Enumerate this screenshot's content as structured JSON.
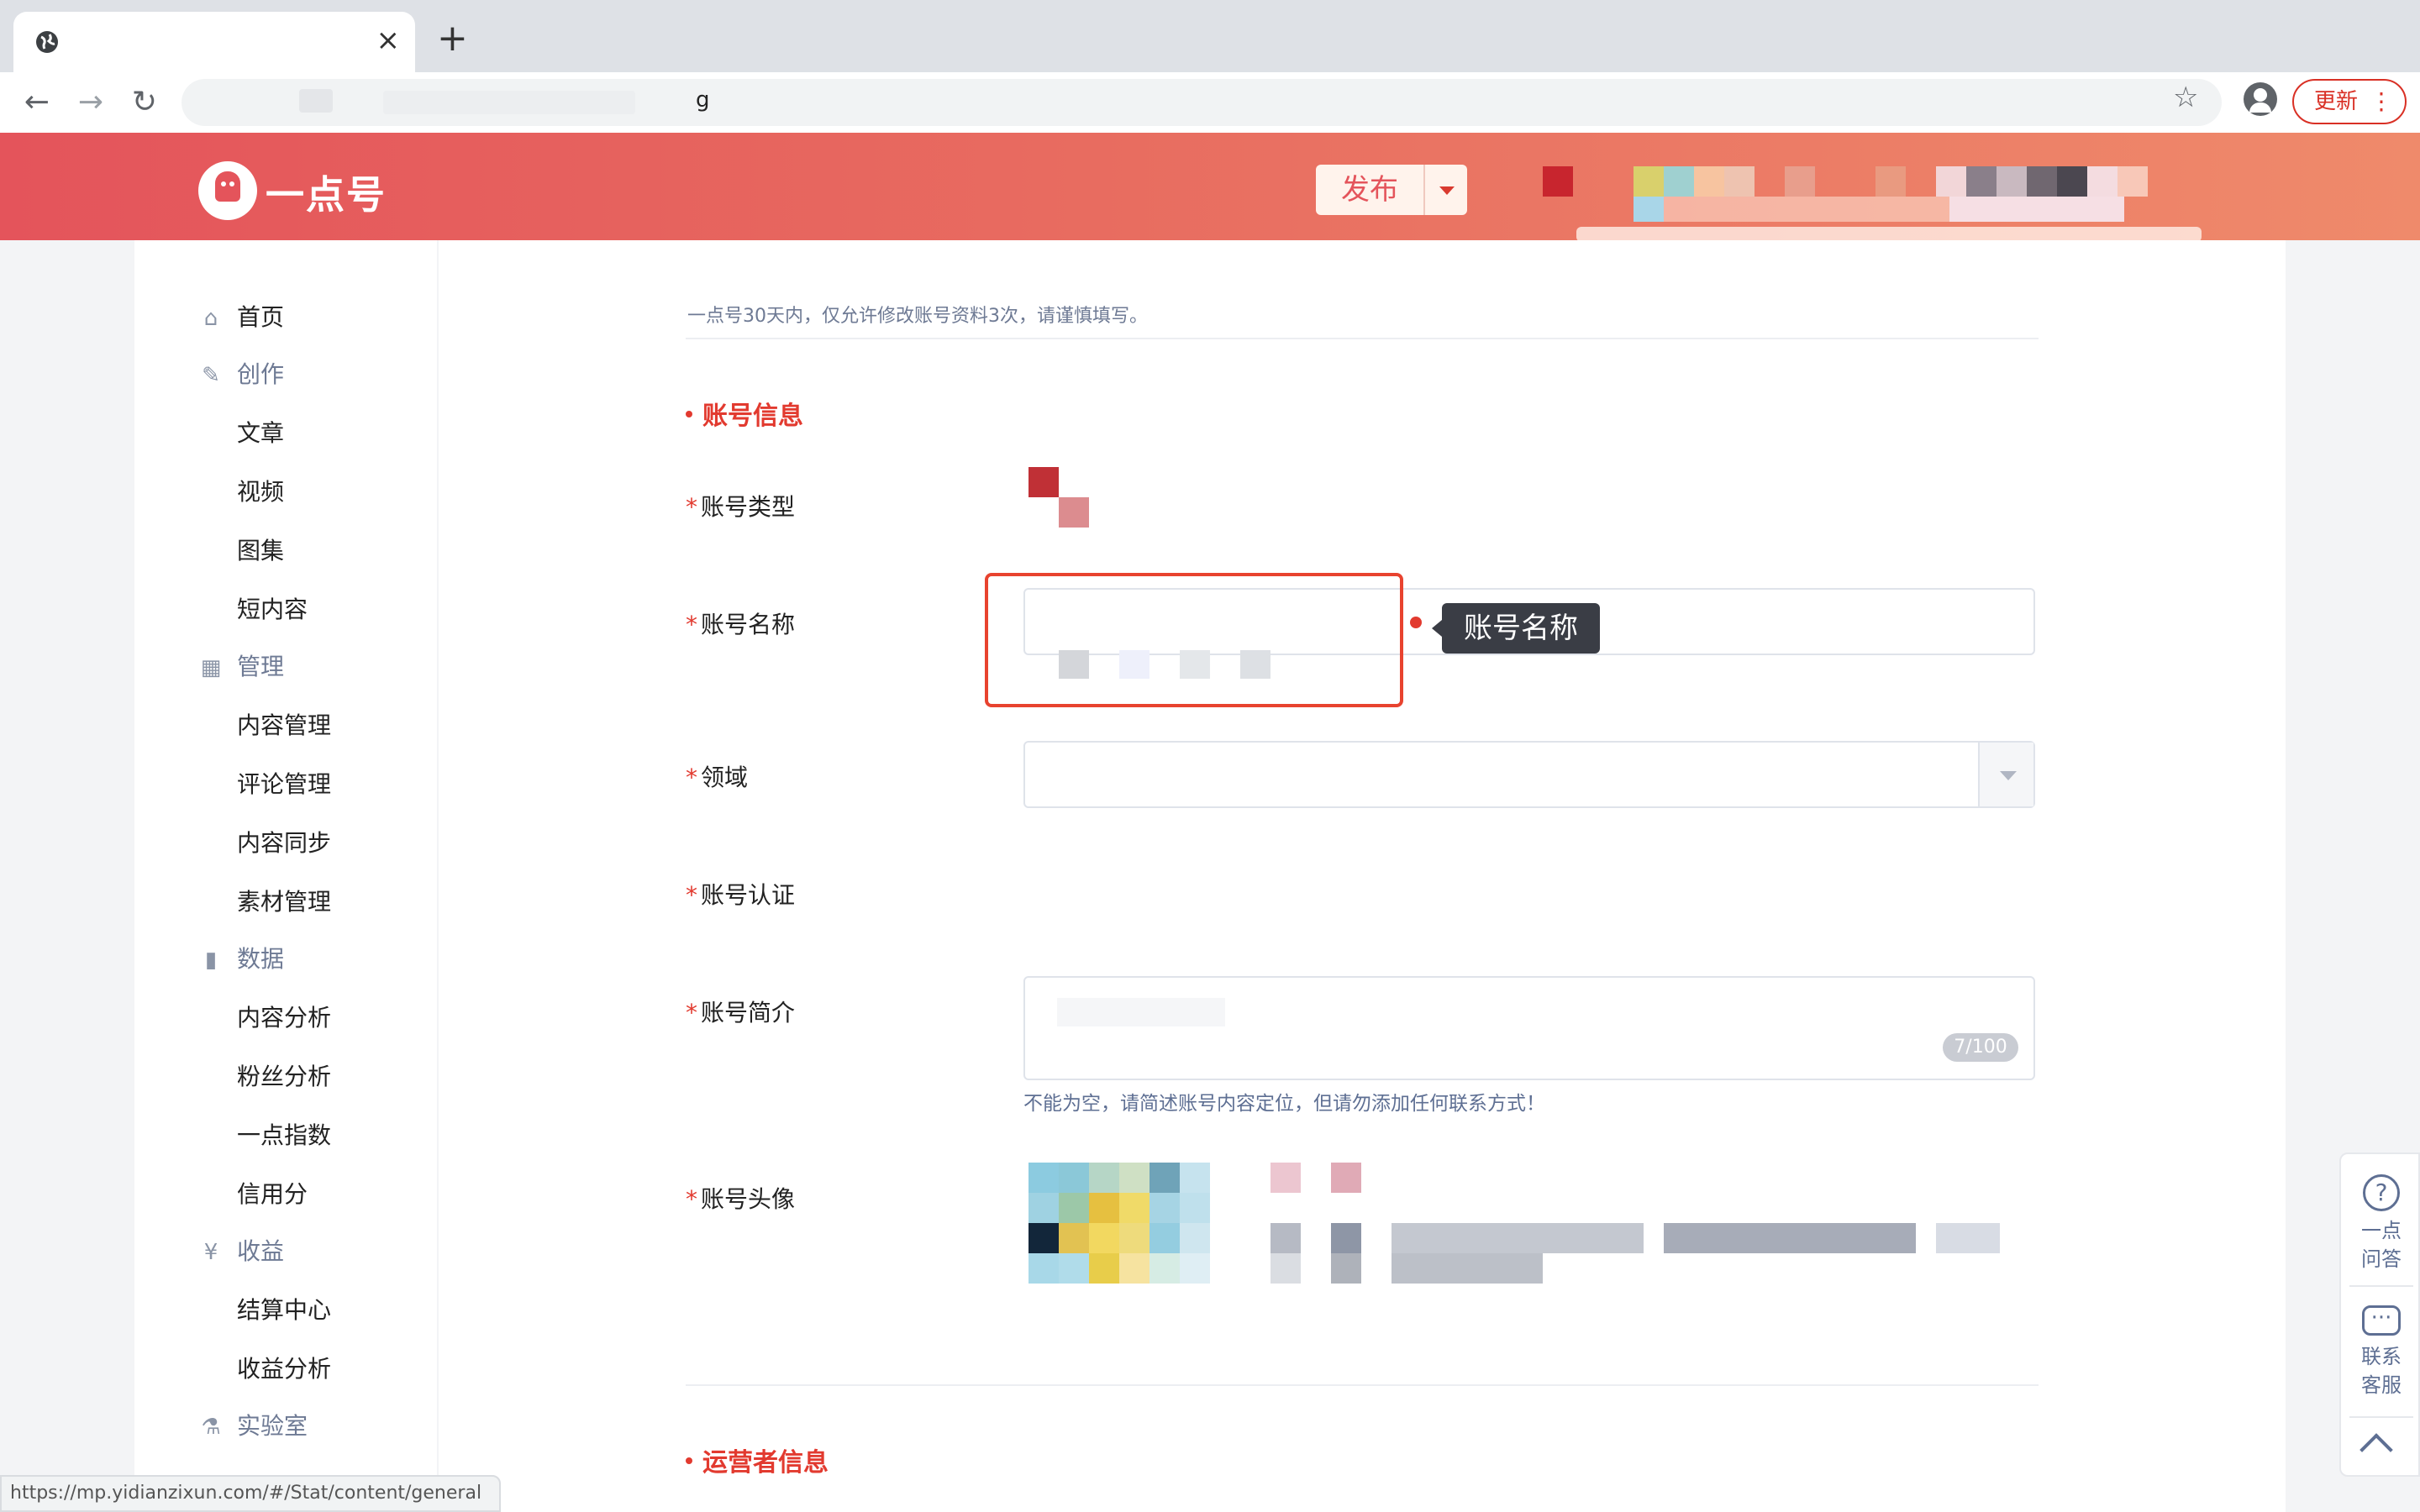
{
  "browser": {
    "tab_title": "",
    "new_tab": "+",
    "tab_close": "×",
    "url_visible": "g",
    "update_label": "更新",
    "menu_dots": "⋮",
    "back": "←",
    "forward": "→",
    "reload": "↻",
    "star": "☆",
    "status_url": "https://mp.yidianzixun.com/#/Stat/content/general"
  },
  "header": {
    "logo_text": "一点号",
    "publish_label": "发布"
  },
  "sidebar": {
    "items": [
      {
        "label": "首页",
        "type": "group",
        "icon": "home-icon",
        "glyph": "⌂"
      },
      {
        "label": "创作",
        "type": "group",
        "icon": "pen-icon",
        "glyph": "✎"
      },
      {
        "label": "文章",
        "type": "sub"
      },
      {
        "label": "视频",
        "type": "sub"
      },
      {
        "label": "图集",
        "type": "sub"
      },
      {
        "label": "短内容",
        "type": "sub"
      },
      {
        "label": "管理",
        "type": "group",
        "icon": "grid-icon",
        "glyph": "▦"
      },
      {
        "label": "内容管理",
        "type": "sub"
      },
      {
        "label": "评论管理",
        "type": "sub"
      },
      {
        "label": "内容同步",
        "type": "sub"
      },
      {
        "label": "素材管理",
        "type": "sub"
      },
      {
        "label": "数据",
        "type": "group",
        "icon": "bar-chart-icon",
        "glyph": "▮"
      },
      {
        "label": "内容分析",
        "type": "sub"
      },
      {
        "label": "粉丝分析",
        "type": "sub"
      },
      {
        "label": "一点指数",
        "type": "sub"
      },
      {
        "label": "信用分",
        "type": "sub"
      },
      {
        "label": "收益",
        "type": "group",
        "icon": "yen-icon",
        "glyph": "¥"
      },
      {
        "label": "结算中心",
        "type": "sub"
      },
      {
        "label": "收益分析",
        "type": "sub"
      },
      {
        "label": "实验室",
        "type": "group",
        "icon": "lab-icon",
        "glyph": "⚗"
      }
    ]
  },
  "content": {
    "notice": "一点号30天内，仅允许修改账号资料3次，请谨慎填写。",
    "section_account": "账号信息",
    "section_operator": "运营者信息",
    "fields": {
      "type": "账号类型",
      "name": "账号名称",
      "domain": "领域",
      "cert": "账号认证",
      "intro": "账号简介",
      "avatar": "账号头像"
    },
    "required_mark": "*",
    "tooltip": "账号名称",
    "intro_counter": "7/100",
    "intro_hint": "不能为空，请简述账号内容定位，但请勿添加任何联系方式！"
  },
  "float_panel": {
    "qa_line1": "一点",
    "qa_line2": "问答",
    "cs_line1": "联系",
    "cs_line2": "客服",
    "qa_glyph": "?",
    "cs_glyph": "···"
  },
  "colors": {
    "brand": "#e4545b",
    "accent_red": "#e23a2f",
    "header_gradient_end": "#ef8a6b"
  }
}
